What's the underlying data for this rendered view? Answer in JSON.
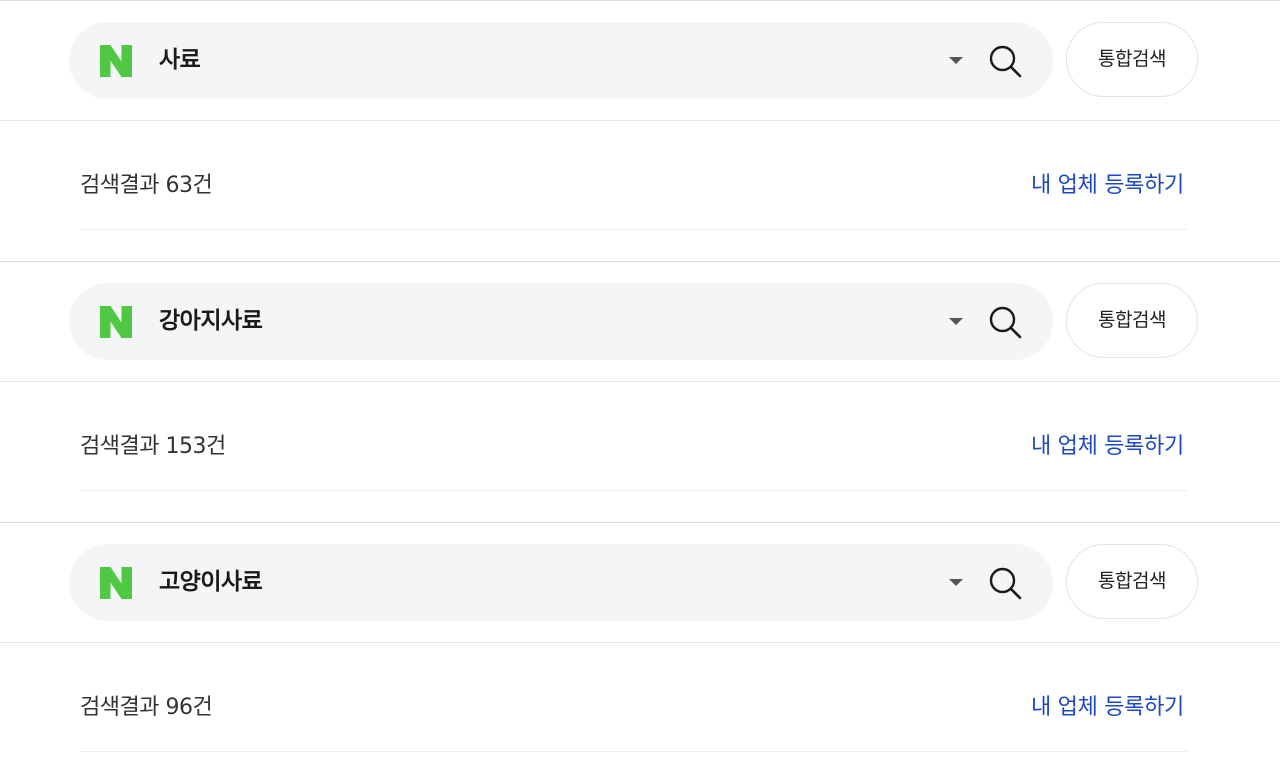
{
  "colors": {
    "naver_green": "#50c843",
    "link_blue": "#1c49c2",
    "pill_bg": "#f4f5f7"
  },
  "blocks": [
    {
      "query": "사료",
      "search_button_label": "통합검색",
      "result_count": "검색결과 63건",
      "register_link": "내 업체 등록하기"
    },
    {
      "query": "강아지사료",
      "search_button_label": "통합검색",
      "result_count": "검색결과 153건",
      "register_link": "내 업체 등록하기"
    },
    {
      "query": "고양이사료",
      "search_button_label": "통합검색",
      "result_count": "검색결과 96건",
      "register_link": "내 업체 등록하기"
    }
  ],
  "icons": {
    "logo": "naver-n-logo",
    "dropdown": "caret-down-icon",
    "search": "magnifier-icon"
  }
}
